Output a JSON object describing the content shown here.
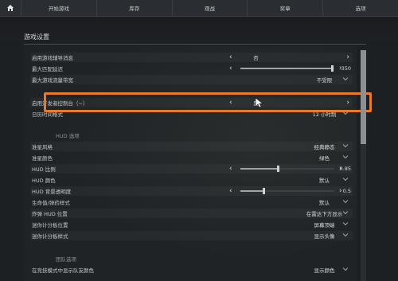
{
  "nav": {
    "items": [
      "开始游戏",
      "库存",
      "观战",
      "奖章",
      "选项"
    ]
  },
  "page": {
    "title": "游戏设置"
  },
  "rows": [
    {
      "label": "启用游戏辅导消息",
      "value": "否",
      "type": "arrows"
    },
    {
      "label": "最大匹配延迟",
      "value": "350",
      "type": "slider",
      "fraction": 0.98
    },
    {
      "label": "最大游戏流量带宽",
      "value": "不受限",
      "type": "dropdown"
    },
    {
      "label": "",
      "value": "",
      "type": "partial"
    },
    {
      "label": "启用开发者控制台（~）",
      "value": "是",
      "type": "arrows"
    },
    {
      "label": "日历时间格式",
      "value": "12 小时制",
      "type": "dropdown"
    }
  ],
  "hud": {
    "section": "HUD 选项",
    "rows": [
      {
        "label": "准星风格",
        "value": "经典静态",
        "type": "dropdown"
      },
      {
        "label": "准星颜色",
        "value": "绿色",
        "type": "dropdown"
      },
      {
        "label": "HUD 比例",
        "value": "0.85",
        "type": "slider",
        "fraction": 0.4
      },
      {
        "label": "HUD 颜色",
        "value": "默认",
        "type": "dropdown"
      },
      {
        "label": "HUD 背景透明度",
        "value": "0.5",
        "type": "slider",
        "fraction": 0.25
      },
      {
        "label": "生命值/弹药样式",
        "value": "默认",
        "type": "dropdown"
      },
      {
        "label": "炸弹 HUD 位置",
        "value": "在雷达下方显示",
        "type": "dropdown"
      },
      {
        "label": "迷你计分板位置",
        "value": "屏幕顶端",
        "type": "dropdown"
      },
      {
        "label": "迷你计分板样式",
        "value": "显示头像",
        "type": "dropdown"
      }
    ]
  },
  "team": {
    "section": "团队选项",
    "rows": [
      {
        "label": "在竞技模式中显示队友颜色",
        "value": "显示颜色",
        "type": "dropdown"
      }
    ]
  },
  "colors": {
    "highlight": "#e87a2a"
  }
}
